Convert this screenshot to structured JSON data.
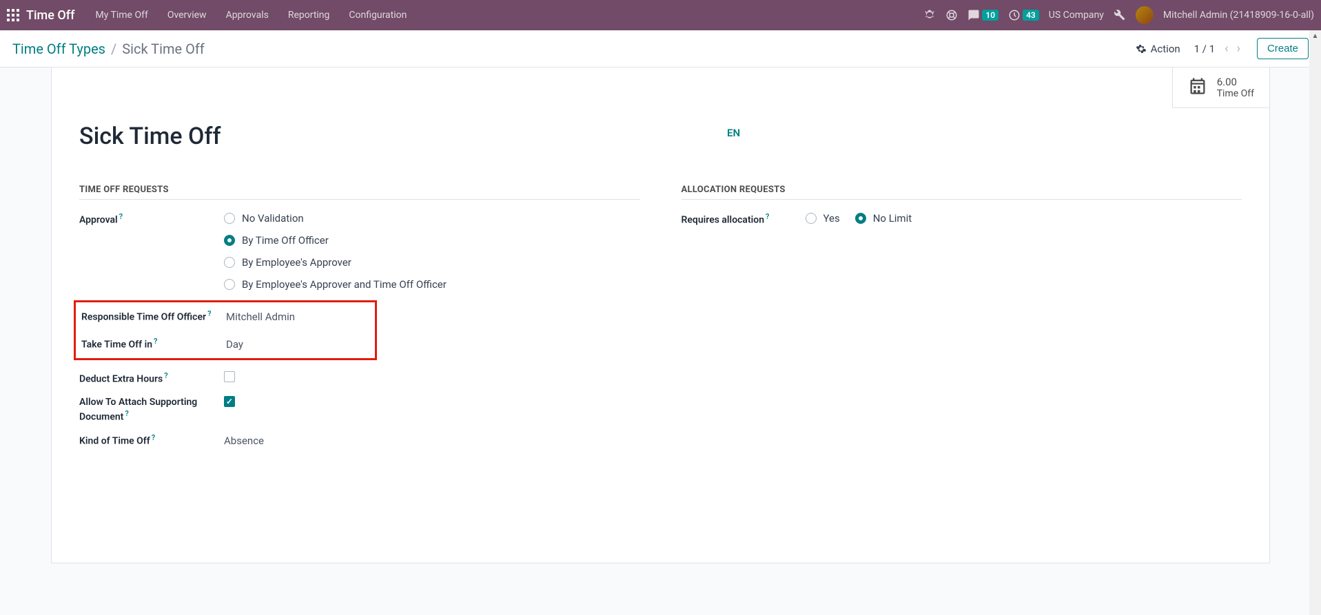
{
  "topbar": {
    "brand": "Time Off",
    "nav": [
      "My Time Off",
      "Overview",
      "Approvals",
      "Reporting",
      "Configuration"
    ],
    "msg_badge": "10",
    "activity_badge": "43",
    "company": "US Company",
    "user": "Mitchell Admin (21418909-16-0-all)"
  },
  "controlbar": {
    "crumb_root": "Time Off Types",
    "crumb_current": "Sick Time Off",
    "action_label": "Action",
    "pager": "1 / 1",
    "create_label": "Create"
  },
  "stat": {
    "value": "6.00",
    "label": "Time Off"
  },
  "form": {
    "title": "Sick Time Off",
    "lang": "EN",
    "section_left": "TIME OFF REQUESTS",
    "section_right": "ALLOCATION REQUESTS",
    "labels": {
      "approval": "Approval",
      "responsible": "Responsible Time Off Officer",
      "take_in": "Take Time Off in",
      "deduct": "Deduct Extra Hours",
      "attach": "Allow To Attach Supporting Document",
      "kind": "Kind of Time Off",
      "requires_alloc": "Requires allocation"
    },
    "approval_options": [
      "No Validation",
      "By Time Off Officer",
      "By Employee's Approver",
      "By Employee's Approver and Time Off Officer"
    ],
    "approval_selected": 1,
    "responsible_value": "Mitchell Admin",
    "take_in_value": "Day",
    "deduct_checked": false,
    "attach_checked": true,
    "kind_value": "Absence",
    "alloc_options": [
      "Yes",
      "No Limit"
    ],
    "alloc_selected": 1
  }
}
